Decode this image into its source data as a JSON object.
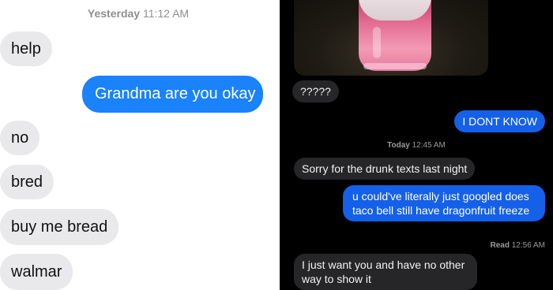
{
  "left_chat": {
    "timestamp_day": "Yesterday",
    "timestamp_time": "11:12 AM",
    "messages": [
      {
        "from": "them",
        "text": "help"
      },
      {
        "from": "me",
        "text": "Grandma are you okay"
      },
      {
        "from": "them",
        "text": "no"
      },
      {
        "from": "them",
        "text": "bred"
      },
      {
        "from": "them",
        "text": "buy me bread"
      },
      {
        "from": "them",
        "text": "walmar"
      }
    ]
  },
  "right_chat": {
    "photo_description_icon": "pink-drink-cup-photo",
    "messages_before": [
      {
        "from": "them",
        "text": "?????"
      },
      {
        "from": "me",
        "text": "I DONT KNOW"
      }
    ],
    "timestamp_day": "Today",
    "timestamp_time": "12:45 AM",
    "messages_after": [
      {
        "from": "them",
        "text": "Sorry for the drunk texts last night"
      },
      {
        "from": "me",
        "text": "u could've literally just googled does taco bell still have dragonfruit freeze"
      },
      {
        "from": "them",
        "text": "I just want you and have no other way to show it"
      }
    ],
    "read_label": "Read",
    "read_time": "12:56 AM"
  },
  "colors": {
    "ios_blue": "#1a82fb",
    "ios_gray": "#e9e9eb",
    "dark_in": "#262628",
    "dark_out": "#1560e8"
  }
}
